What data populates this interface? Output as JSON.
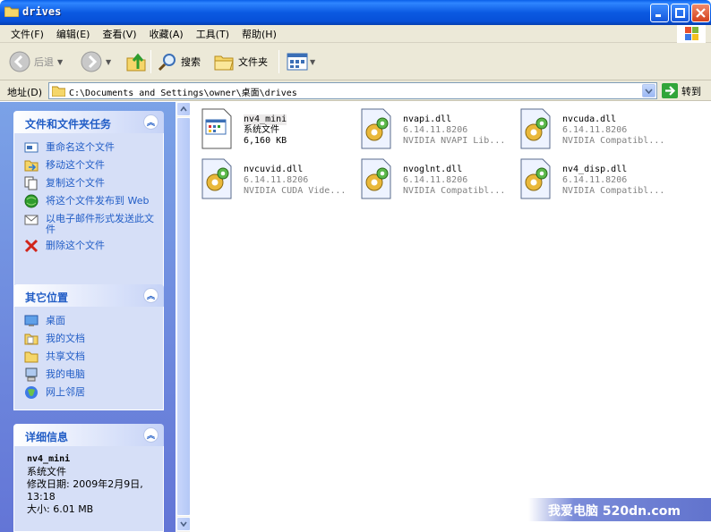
{
  "window": {
    "title": "drives",
    "colors": {
      "titlebar": "#0a5fe9",
      "close": "#d4411c"
    }
  },
  "menu": [
    {
      "label": "文件(F)"
    },
    {
      "label": "编辑(E)"
    },
    {
      "label": "查看(V)"
    },
    {
      "label": "收藏(A)"
    },
    {
      "label": "工具(T)"
    },
    {
      "label": "帮助(H)"
    }
  ],
  "toolbar": {
    "back_label": "后退",
    "search_label": "搜索",
    "folders_label": "文件夹"
  },
  "address": {
    "label": "地址(D)",
    "value": "C:\\Documents and Settings\\owner\\桌面\\drives",
    "go_label": "转到"
  },
  "tasks_panel": {
    "title": "文件和文件夹任务",
    "items": [
      {
        "label": "重命名这个文件",
        "icon": "rename-icon"
      },
      {
        "label": "移动这个文件",
        "icon": "move-icon"
      },
      {
        "label": "复制这个文件",
        "icon": "copy-icon"
      },
      {
        "label": "将这个文件发布到 Web",
        "icon": "publish-web-icon"
      },
      {
        "label": "以电子邮件形式发送此文件",
        "icon": "email-icon"
      },
      {
        "label": "删除这个文件",
        "icon": "delete-icon"
      }
    ]
  },
  "places_panel": {
    "title": "其它位置",
    "items": [
      {
        "label": "桌面",
        "icon": "desktop-icon"
      },
      {
        "label": "我的文档",
        "icon": "my-documents-icon"
      },
      {
        "label": "共享文档",
        "icon": "shared-documents-icon"
      },
      {
        "label": "我的电脑",
        "icon": "my-computer-icon"
      },
      {
        "label": "网上邻居",
        "icon": "network-icon"
      }
    ]
  },
  "details_panel": {
    "title": "详细信息",
    "name": "nv4_mini",
    "type": "系统文件",
    "modified": "修改日期: 2009年2月9日, 13:18",
    "size": "大小: 6.01 MB"
  },
  "files": [
    {
      "name": "nv4_mini",
      "line2": "系统文件",
      "line3": "6,160 KB",
      "icon": "system-file-icon",
      "selected": true
    },
    {
      "name": "nvapi.dll",
      "line2": "6.14.11.8206",
      "line3": "NVIDIA NVAPI Lib...",
      "icon": "dll-icon"
    },
    {
      "name": "nvcuda.dll",
      "line2": "6.14.11.8206",
      "line3": "NVIDIA Compatibl...",
      "icon": "dll-icon"
    },
    {
      "name": "nvcuvid.dll",
      "line2": "6.14.11.8206",
      "line3": "NVIDIA CUDA Vide...",
      "icon": "dll-icon"
    },
    {
      "name": "nvoglnt.dll",
      "line2": "6.14.11.8206",
      "line3": "NVIDIA Compatibl...",
      "icon": "dll-icon"
    },
    {
      "name": "nv4_disp.dll",
      "line2": "6.14.11.8206",
      "line3": "NVIDIA Compatibl...",
      "icon": "dll-icon"
    }
  ],
  "watermark": "我爱电脑 520dn.com"
}
